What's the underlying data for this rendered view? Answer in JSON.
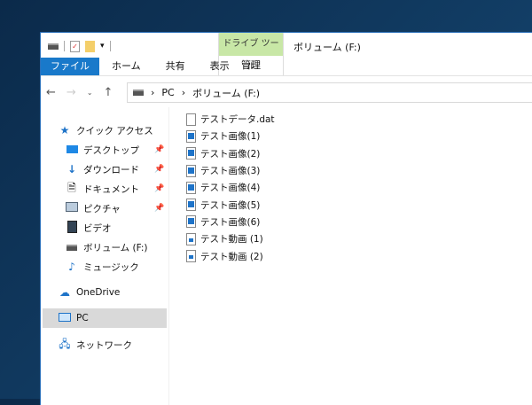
{
  "window": {
    "title": "ボリューム (F:)",
    "context_group": "ドライブ ツール",
    "context_tab": "管理"
  },
  "ribbon": {
    "tabs": [
      "ファイル",
      "ホーム",
      "共有",
      "表示"
    ]
  },
  "address": {
    "path": [
      "PC",
      "ボリューム (F:)"
    ]
  },
  "nav_pane": {
    "items": [
      {
        "label": "クイック アクセス",
        "icon": "star-icon"
      },
      {
        "label": "デスクトップ",
        "icon": "desktop-icon",
        "pinned": true
      },
      {
        "label": "ダウンロード",
        "icon": "download-icon",
        "pinned": true
      },
      {
        "label": "ドキュメント",
        "icon": "document-icon",
        "pinned": true
      },
      {
        "label": "ピクチャ",
        "icon": "picture-icon",
        "pinned": true
      },
      {
        "label": "ビデオ",
        "icon": "video-icon"
      },
      {
        "label": "ボリューム (F:)",
        "icon": "drive-icon"
      },
      {
        "label": "ミュージック",
        "icon": "music-icon"
      },
      {
        "label": "OneDrive",
        "icon": "cloud-icon"
      },
      {
        "label": "PC",
        "icon": "pc-icon",
        "selected": true
      },
      {
        "label": "ネットワーク",
        "icon": "network-icon"
      }
    ]
  },
  "files": [
    {
      "name": "テストデータ.dat",
      "type": "file"
    },
    {
      "name": "テスト画像(1)",
      "type": "image"
    },
    {
      "name": "テスト画像(2)",
      "type": "image"
    },
    {
      "name": "テスト画像(3)",
      "type": "image"
    },
    {
      "name": "テスト画像(4)",
      "type": "image"
    },
    {
      "name": "テスト画像(5)",
      "type": "image"
    },
    {
      "name": "テスト画像(6)",
      "type": "image"
    },
    {
      "name": "テスト動画 (1)",
      "type": "video"
    },
    {
      "name": "テスト動画 (2)",
      "type": "video"
    }
  ]
}
